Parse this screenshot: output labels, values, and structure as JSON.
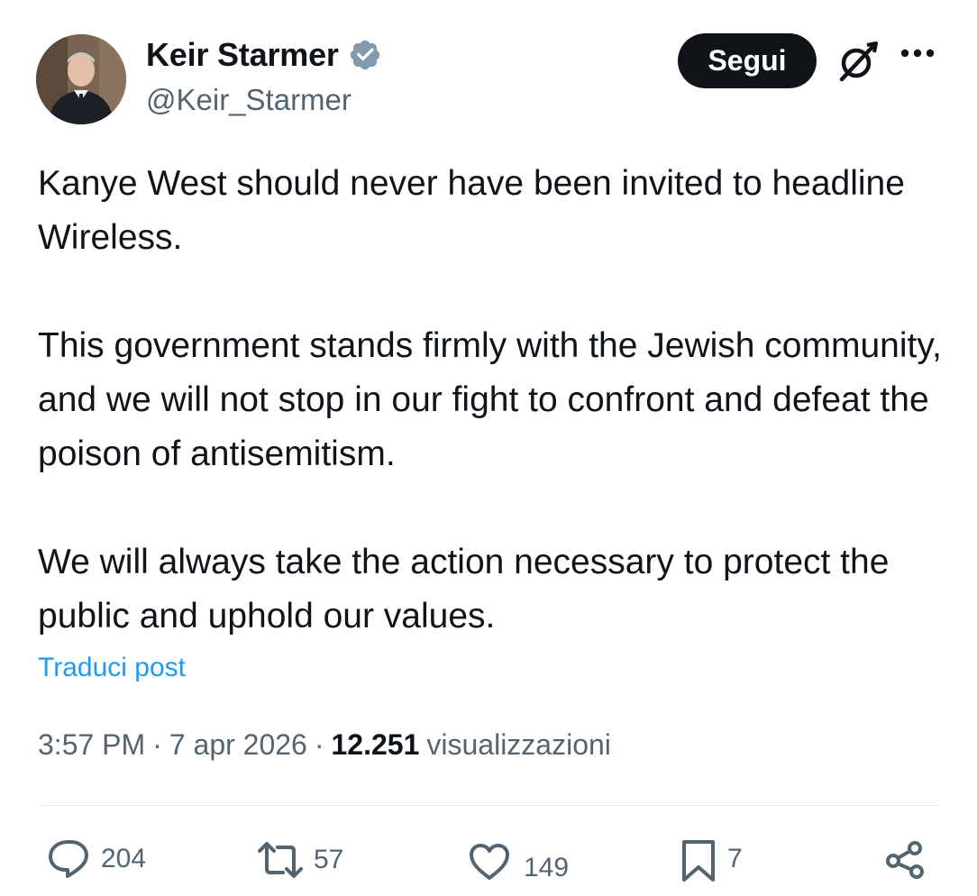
{
  "author": {
    "display_name": "Keir Starmer",
    "handle": "@Keir_Starmer",
    "verified": true,
    "avatar_icon": "profile-photo"
  },
  "header": {
    "follow_label": "Segui",
    "grok_icon": "grok-icon",
    "more_icon": "more-dots-icon"
  },
  "post": {
    "paragraphs": [
      "Kanye West should never have been invited to headline Wireless.",
      "This government stands firmly with the Jewish community, and we will not stop in our fight to confront and defeat the poison of antisemitism.",
      "We will always take the action necessary to protect the public and uphold our values."
    ],
    "translate_label": "Traduci post"
  },
  "meta": {
    "time": "3:57 PM",
    "separator": "·",
    "date": "7 apr 2026",
    "views_count": "12.251",
    "views_label": "visualizzazioni"
  },
  "actions": {
    "replies": "204",
    "reposts": "57",
    "likes": "149",
    "bookmarks": "7"
  },
  "colors": {
    "text_primary": "#0f1419",
    "text_secondary": "#536471",
    "link_blue": "#1d9bf0",
    "verified_badge": "#829aab",
    "follow_bg": "#0f1419"
  }
}
